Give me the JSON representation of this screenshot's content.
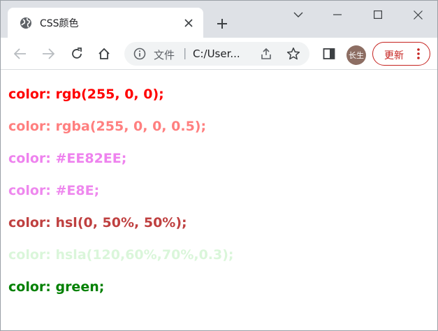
{
  "tab": {
    "title": "CSS颜色",
    "favicon": "globe-icon",
    "close_icon": "close-icon"
  },
  "window_controls": {
    "dropdown_icon": "chevron-down-icon",
    "minimize_icon": "minimize-icon",
    "maximize_icon": "maximize-icon",
    "close_icon": "close-icon"
  },
  "toolbar": {
    "back_icon": "arrow-left-icon",
    "forward_icon": "arrow-right-icon",
    "reload_icon": "reload-icon",
    "home_icon": "home-icon",
    "omnibox": {
      "info_icon": "info-icon",
      "label": "文件",
      "separator": "|",
      "url": "C:/User..."
    },
    "share_icon": "share-icon",
    "bookmark_icon": "star-icon",
    "sidepanel_icon": "side-panel-icon",
    "avatar_text": "长生",
    "avatar_color": "#8d6e63",
    "update_label": "更新",
    "update_color": "#c5221f",
    "more_icon": "more-vertical-icon"
  },
  "content": {
    "lines": [
      {
        "text": "color: rgb(255, 0, 0);",
        "color": "rgb(255, 0, 0)"
      },
      {
        "text": "color: rgba(255, 0, 0, 0.5);",
        "color": "rgba(255, 0, 0, 0.5)"
      },
      {
        "text": "color: #EE82EE;",
        "color": "#EE82EE"
      },
      {
        "text": "color: #E8E;",
        "color": "#E8E"
      },
      {
        "text": "color: hsl(0, 50%, 50%);",
        "color": "hsl(0, 50%, 50%)"
      },
      {
        "text": "color: hsla(120,60%,70%,0.3);",
        "color": "hsla(120,60%,70%,0.3)"
      },
      {
        "text": "color: green;",
        "color": "green"
      }
    ]
  }
}
